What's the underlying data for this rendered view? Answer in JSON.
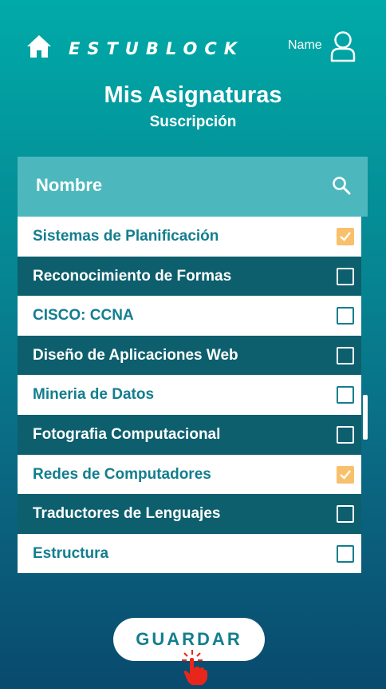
{
  "header": {
    "brand": "ESTUBLOCK",
    "user_name": "Name",
    "icons": {
      "home": "home-icon",
      "user": "user-icon"
    }
  },
  "page": {
    "title": "Mis Asignaturas",
    "subtitle": "Suscripción"
  },
  "list": {
    "header_label": "Nombre",
    "search_icon": "search-icon",
    "items": [
      {
        "label": "Sistemas de Planificación",
        "checked": true
      },
      {
        "label": "Reconocimiento de Formas",
        "checked": false
      },
      {
        "label": "CISCO: CCNA",
        "checked": false
      },
      {
        "label": "Diseño de Aplicaciones Web",
        "checked": false
      },
      {
        "label": "Mineria de Datos",
        "checked": false
      },
      {
        "label": "Fotografia Computacional",
        "checked": false
      },
      {
        "label": "Redes de Computadores",
        "checked": true
      },
      {
        "label": "Traductores de Lenguajes",
        "checked": false
      },
      {
        "label": "Estructura",
        "checked": false
      }
    ]
  },
  "actions": {
    "save_label": "GUARDAR"
  },
  "colors": {
    "accent": "#137e8e",
    "dark_row": "#0d5f6d",
    "header_bar": "#4cb8bd",
    "checked": "#f9c06b",
    "cursor": "#e8261c"
  }
}
